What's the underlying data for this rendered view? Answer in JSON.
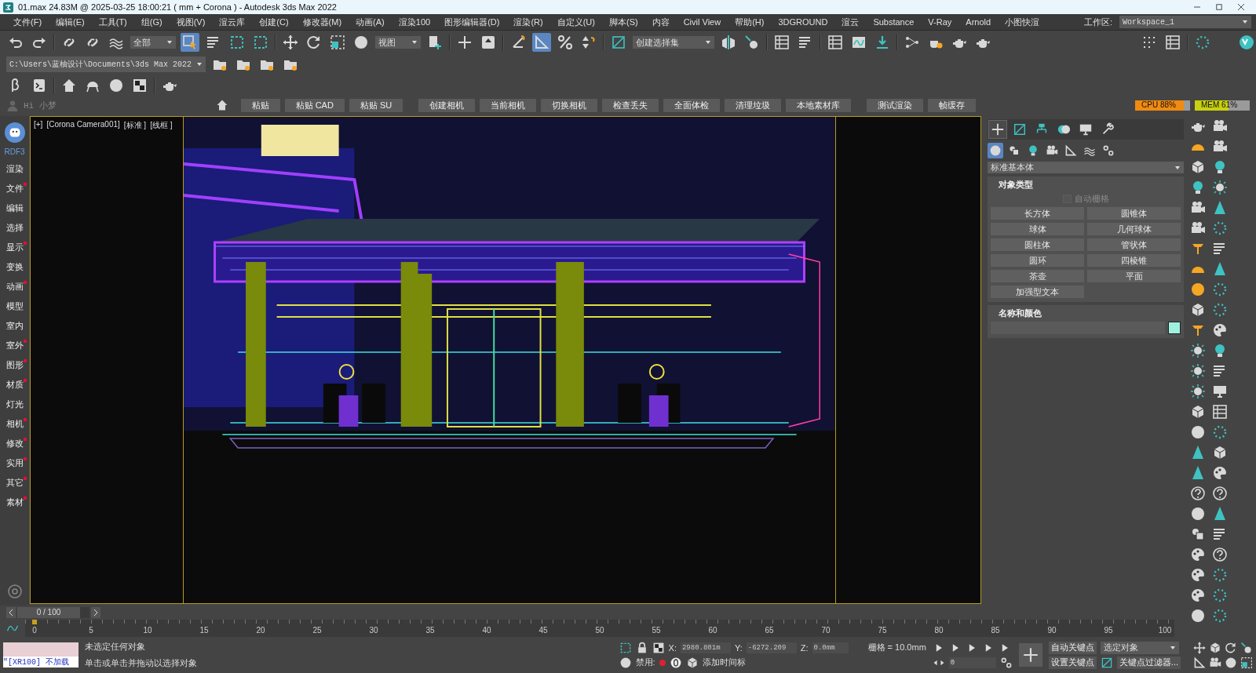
{
  "window": {
    "title": "01.max  24.83M @ 2025-03-25 18:00:21  ( mm + Corona ) - Autodesk 3ds Max 2022"
  },
  "menu": [
    "文件(F)",
    "编辑(E)",
    "工具(T)",
    "组(G)",
    "视图(V)",
    "渲云库",
    "创建(C)",
    "修改器(M)",
    "动画(A)",
    "渲染100",
    "图形编辑器(D)",
    "渲染(R)",
    "自定义(U)",
    "脚本(S)",
    "内容",
    "Civil View",
    "帮助(H)",
    "3DGROUND",
    "渲云",
    "Substance",
    "V-Ray",
    "Arnold",
    "小图快渲"
  ],
  "workspace": {
    "label": "工作区:",
    "value": "Workspace_1"
  },
  "main_toolbar": {
    "selection_filter": "全部",
    "reference_coordinate": "视图",
    "named_selection": "创建选择集",
    "select_tool": {
      "selected": true
    },
    "angle_snap": {
      "selected": true
    }
  },
  "project_path": "C:\\Users\\蓝柚设计\\Documents\\3ds Max 2022",
  "quick_bar": {
    "user": "Hi 小梦",
    "buttons": [
      "粘贴",
      "粘贴 CAD",
      "粘贴 SU",
      "创建相机",
      "当前相机",
      "切换相机",
      "检查丢失",
      "全面体检",
      "清理垃圾",
      "本地素材库",
      "测试渲染",
      "帧缓存"
    ],
    "meters": [
      {
        "label": "CPU 88%",
        "level": 0.88,
        "color": "#f08a10"
      },
      {
        "label": "MEM 61%",
        "level": 0.61,
        "color": "#c8d010"
      }
    ]
  },
  "sidebar": {
    "title": "RDF3",
    "items": [
      {
        "label": "渲染",
        "badge": false
      },
      {
        "label": "文件",
        "badge": true
      },
      {
        "label": "编辑",
        "badge": false
      },
      {
        "label": "选择",
        "badge": false
      },
      {
        "label": "显示",
        "badge": true
      },
      {
        "label": "变换",
        "badge": false
      },
      {
        "label": "动画",
        "badge": true
      },
      {
        "label": "模型",
        "badge": false
      },
      {
        "label": "室内",
        "badge": false
      },
      {
        "label": "室外",
        "badge": true
      },
      {
        "label": "图形",
        "badge": true
      },
      {
        "label": "材质",
        "badge": true
      },
      {
        "label": "灯光",
        "badge": false
      },
      {
        "label": "相机",
        "badge": true
      },
      {
        "label": "修改",
        "badge": true
      },
      {
        "label": "实用",
        "badge": true
      },
      {
        "label": "其它",
        "badge": true
      },
      {
        "label": "素材",
        "badge": true
      }
    ]
  },
  "viewport": {
    "labels": [
      "[+]",
      "[Corona Camera001]",
      "[标准 ]",
      "[线框 ]"
    ]
  },
  "command_panel": {
    "tabs": [
      {
        "selected": true
      },
      {
        "selected": false
      },
      {
        "selected": false
      },
      {
        "selected": false
      },
      {
        "selected": false
      },
      {
        "selected": false
      }
    ],
    "categories": [
      {
        "selected": true
      },
      {
        "selected": false
      },
      {
        "selected": false
      },
      {
        "selected": false
      },
      {
        "selected": false
      },
      {
        "selected": false
      },
      {
        "selected": false
      }
    ],
    "dropdown": "标准基本体",
    "object_type": {
      "title": "对象类型",
      "autogrid": {
        "label": "自动栅格",
        "checked": false
      },
      "buttons": [
        "长方体",
        "圆锥体",
        "球体",
        "几何球体",
        "圆柱体",
        "管状体",
        "圆环",
        "四棱锥",
        "茶壶",
        "平面",
        "加强型文本"
      ]
    },
    "name_color": {
      "title": "名称和颜色",
      "color": "#a0f0e0"
    }
  },
  "time_slider": {
    "label": "0 / 100",
    "level": 0
  },
  "ruler": {
    "ticks": [
      "0",
      "5",
      "10",
      "15",
      "20",
      "25",
      "30",
      "35",
      "40",
      "45",
      "50",
      "55",
      "60",
      "65",
      "70",
      "75",
      "80",
      "85",
      "90",
      "95",
      "100"
    ]
  },
  "status": {
    "script_text": "\"[XR100] 不加载",
    "prompt": "未选定任何对象",
    "hint": "单击或单击并拖动以选择对象",
    "x": {
      "label": "X:",
      "value": "2980.801m"
    },
    "y": {
      "label": "Y:",
      "value": "-6272.209"
    },
    "z": {
      "label": "Z:",
      "value": "0.0mm"
    },
    "grid": "栅格 = 10.0mm",
    "disable_label": "禁用:",
    "time_tag": "添加时间标",
    "frame": "0",
    "auto_key": "自动关键点",
    "key_mode": "选定对象",
    "set_key": "设置关键点",
    "key_filters": "关键点过滤器..."
  }
}
